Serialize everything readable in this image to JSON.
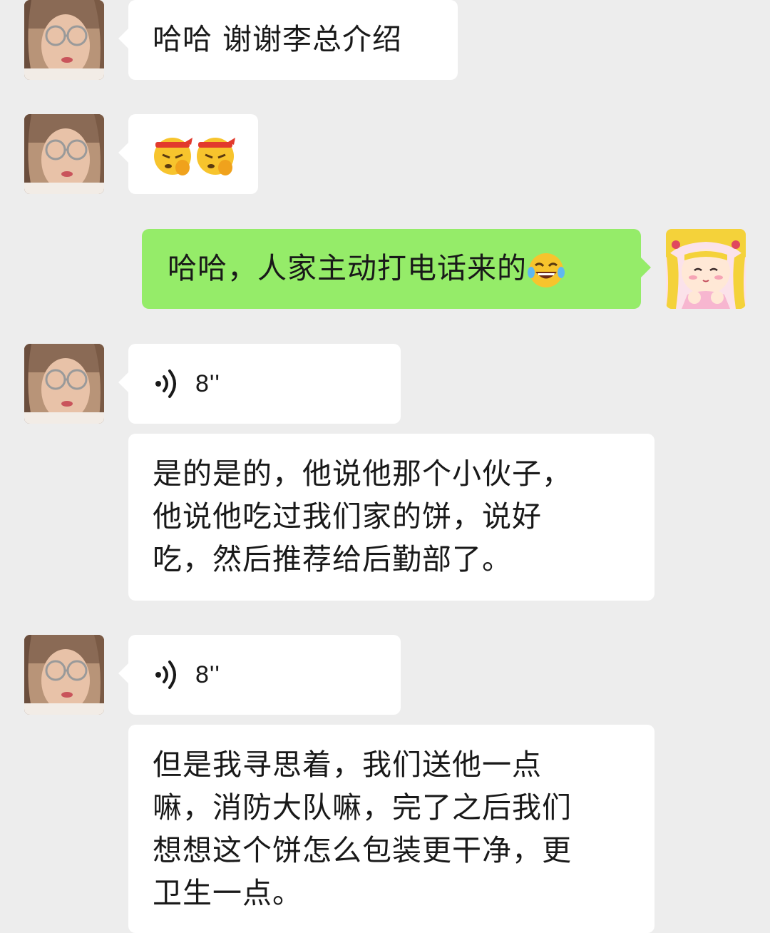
{
  "conversation": {
    "messages": [
      {
        "from": "contact",
        "type": "text",
        "text": "哈哈 谢谢李总介绍"
      },
      {
        "from": "contact",
        "type": "emoji",
        "emojis": [
          "flexed-determined-face-emoji",
          "flexed-determined-face-emoji"
        ]
      },
      {
        "from": "me",
        "type": "text",
        "text": "哈哈，人家主动打电话来的",
        "emoji": "tears-of-joy-emoji"
      },
      {
        "from": "contact",
        "type": "voice",
        "duration": "8''"
      },
      {
        "from": "contact",
        "type": "text",
        "text": "是的是的，他说他那个小伙子，\n他说他吃过我们家的饼，说好\n吃，然后推荐给后勤部了。"
      },
      {
        "from": "contact",
        "type": "voice",
        "duration": "8''"
      },
      {
        "from": "contact",
        "type": "text",
        "text": "但是我寻思着，我们送他一点\n嘛，消防大队嘛，完了之后我们\n想想这个饼怎么包装更干净，更\n卫生一点。"
      }
    ]
  },
  "colors": {
    "background": "#ededed",
    "incoming_bubble": "#ffffff",
    "outgoing_bubble": "#95ec69",
    "text": "#191919"
  },
  "avatars": {
    "contact": "contact-photo-avatar",
    "me": "cartoon-girl-avatar"
  }
}
